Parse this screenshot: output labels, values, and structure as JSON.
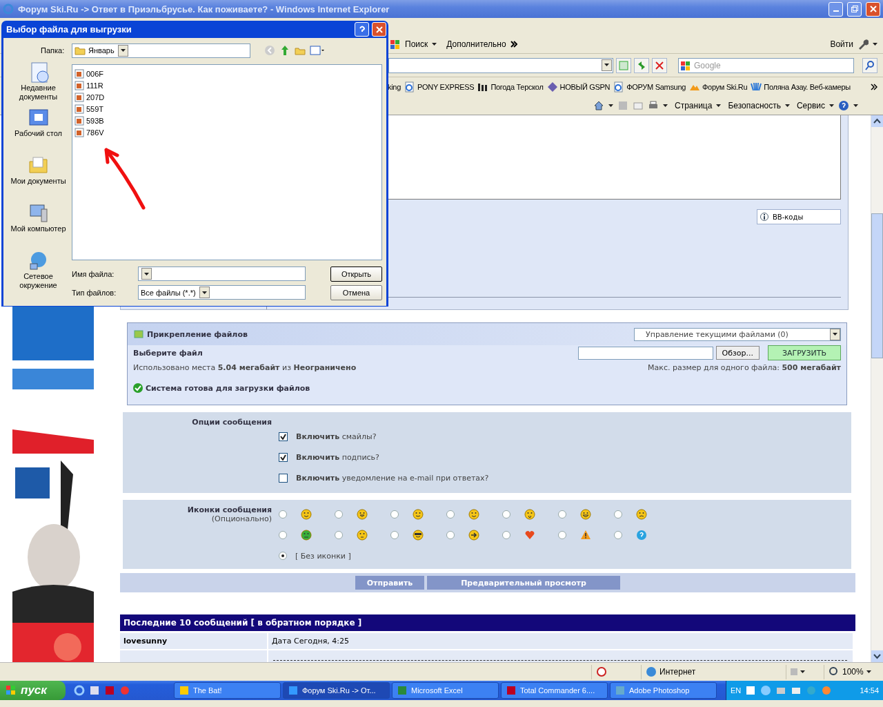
{
  "window": {
    "title": "Форум Ski.Ru -> Ответ в Приэльбрусье. Как поживаете? - Windows Internet Explorer"
  },
  "toolbar": {
    "search": "Поиск",
    "more": "Дополнительно",
    "signin": "Войти"
  },
  "address_bar": {
    "search_placeholder": "Google"
  },
  "links": [
    {
      "label": "king"
    },
    {
      "label": "PONY EXPRESS",
      "kind": "page"
    },
    {
      "label": "Погода Терскол",
      "kind": "letter"
    },
    {
      "label": "НОВЫЙ GSPN",
      "kind": "diamond"
    },
    {
      "label": "ФОРУМ Samsung",
      "kind": "page"
    },
    {
      "label": "Форум Ski.Ru",
      "kind": "mountain"
    },
    {
      "label": "Поляна Азау. Веб-камеры",
      "kind": "rays"
    }
  ],
  "command_bar": [
    {
      "label": "Страница"
    },
    {
      "label": "Безопасность"
    },
    {
      "label": "Сервис"
    }
  ],
  "page": {
    "bbcodes": "BB-коды",
    "attachments": {
      "title": "Прикрепление файлов",
      "manage": "Управление текущими файлами (0)",
      "choose": "Выберите файл",
      "browse": "Обзор...",
      "upload": "ЗАГРУЗИТЬ",
      "usage": "Использовано места **5.04 мегабайт** из **Неограничено**",
      "max_size": "Макс. размер для одного файла: **500 мегабайт**",
      "status": "Система готова для загрузки файлов"
    },
    "options": {
      "title": "Опции сообщения",
      "items": [
        {
          "text": "**Включить** смайлы?",
          "checked": true
        },
        {
          "text": "**Включить** подпись?",
          "checked": true
        },
        {
          "text": "**Включить** уведомление на e-mail при ответах?",
          "checked": false
        }
      ]
    },
    "icons": {
      "title": "Иконки сообщения",
      "subtitle": "(Опционально)",
      "items": [
        {
          "kind": "smile",
          "selected": false
        },
        {
          "kind": "grin",
          "selected": false
        },
        {
          "kind": "wink",
          "selected": false
        },
        {
          "kind": "tongue",
          "selected": false
        },
        {
          "kind": "surprised",
          "selected": false
        },
        {
          "kind": "laugh",
          "selected": false
        },
        {
          "kind": "angry",
          "selected": false
        },
        {
          "kind": "sick",
          "selected": false
        },
        {
          "kind": "rolleyes",
          "selected": false
        },
        {
          "kind": "cool",
          "selected": false
        },
        {
          "kind": "arrow",
          "selected": false
        },
        {
          "kind": "heart",
          "selected": false
        },
        {
          "kind": "warning",
          "selected": false
        },
        {
          "kind": "question",
          "selected": false
        }
      ],
      "none": {
        "label": "[ Без иконки ]",
        "selected": true
      }
    },
    "buttons": [
      "Отправить",
      "Предварительный просмотр"
    ],
    "recent": {
      "title": "Последние 10 сообщений [ в обратном порядке ]",
      "rows": [
        {
          "author": "lovesunny",
          "date": "Дата Сегодня, 4:25"
        }
      ]
    }
  },
  "dialog": {
    "title": "Выбор файла для выгрузки",
    "folder_label": "Папка:",
    "folder": "Январь",
    "places": [
      {
        "label": "Недавние документы",
        "kind": "recent"
      },
      {
        "label": "Рабочий стол",
        "kind": "desktop"
      },
      {
        "label": "Мои документы",
        "kind": "documents"
      },
      {
        "label": "Мой компьютер",
        "kind": "computer"
      },
      {
        "label": "Сетевое окружение",
        "kind": "network"
      }
    ],
    "files": [
      "006F",
      "111R",
      "207D",
      "559T",
      "593B",
      "786V"
    ],
    "filename_label": "Имя файла:",
    "type_label": "Тип файлов:",
    "type_value": "Все файлы (*.*)",
    "open": "Открыть",
    "cancel": "Отмена"
  },
  "status_bar": {
    "zone": "Интернет",
    "zoom": "100%"
  },
  "taskbar": {
    "start": "пуск",
    "tasks": [
      {
        "label": "The Bat!",
        "selected": false
      },
      {
        "label": "Форум Ski.Ru -> От...",
        "selected": true
      },
      {
        "label": "Microsoft Excel",
        "selected": false
      },
      {
        "label": "Total Commander 6....",
        "selected": false
      },
      {
        "label": "Adobe Photoshop",
        "selected": false
      }
    ],
    "language": "EN",
    "clock": "14:54"
  }
}
